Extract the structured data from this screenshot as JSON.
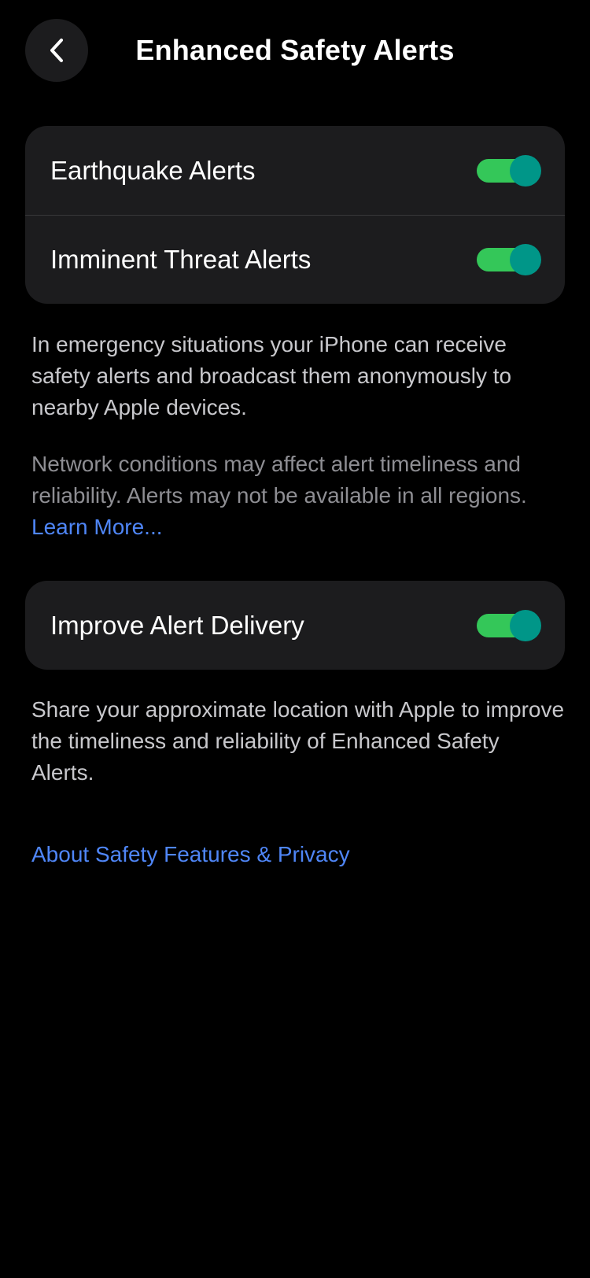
{
  "header": {
    "title": "Enhanced Safety Alerts",
    "back_icon": "chevron-left-icon"
  },
  "alerts_group": {
    "items": [
      {
        "label": "Earthquake Alerts",
        "enabled": true
      },
      {
        "label": "Imminent Threat Alerts",
        "enabled": true
      }
    ]
  },
  "info": {
    "description": "In emergency situations your iPhone can receive safety alerts and broadcast them anonymously to nearby Apple devices.",
    "disclaimer": "Network conditions may affect alert timeliness and reliability. Alerts may not be available in all regions.",
    "learn_more": "Learn More..."
  },
  "delivery_group": {
    "items": [
      {
        "label": "Improve Alert Delivery",
        "enabled": true
      }
    ]
  },
  "delivery_info": {
    "description": "Share your approximate location with Apple to improve the timeliness and reliability of Enhanced Safety Alerts."
  },
  "about_link": "About Safety Features & Privacy",
  "colors": {
    "background": "#000000",
    "card": "#1c1c1e",
    "toggle_track": "#34c759",
    "toggle_knob": "#009688",
    "link": "#4f86f7"
  }
}
